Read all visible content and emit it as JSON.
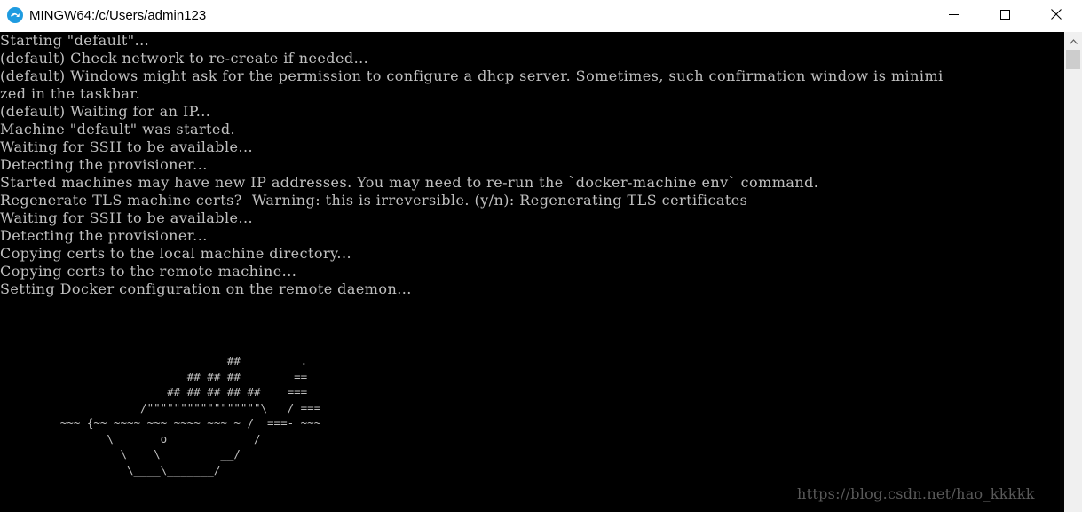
{
  "window": {
    "title": "MINGW64:/c/Users/admin123",
    "icon": "git-bash-app-icon",
    "controls": {
      "minimize_icon": "minimize-icon",
      "maximize_icon": "maximize-icon",
      "close_icon": "close-icon"
    }
  },
  "terminal": {
    "text_color": "#c0c0c0",
    "background": "#000000",
    "lines": [
      "Starting \"default\"...",
      "(default) Check network to re-create if needed...",
      "(default) Windows might ask for the permission to configure a dhcp server. Sometimes, such confirmation window is minimi",
      "zed in the taskbar.",
      "(default) Waiting for an IP...",
      "Machine \"default\" was started.",
      "Waiting for SSH to be available...",
      "Detecting the provisioner...",
      "Started machines may have new IP addresses. You may need to re-run the `docker-machine env` command.",
      "Regenerate TLS machine certs?  Warning: this is irreversible. (y/n): Regenerating TLS certificates",
      "Waiting for SSH to be available...",
      "Detecting the provisioner...",
      "Copying certs to the local machine directory...",
      "Copying certs to the remote machine...",
      "Setting Docker configuration on the remote daemon..."
    ],
    "ascii_art": "                                  ##         .\n                            ## ## ##        ==\n                         ## ## ## ## ##    ===\n                     /\"\"\"\"\"\"\"\"\"\"\"\"\"\"\"\"\"\\___/ ===\n         ~~~ {~~ ~~~~ ~~~ ~~~~ ~~~ ~ /  ===- ~~~\n                \\______ o           __/\n                  \\    \\         __/\n                   \\____\\_______/"
  },
  "watermark": "https://blog.csdn.net/hao_kkkkk",
  "scrollbar": {
    "up_arrow_icon": "scroll-up-arrow-icon"
  }
}
